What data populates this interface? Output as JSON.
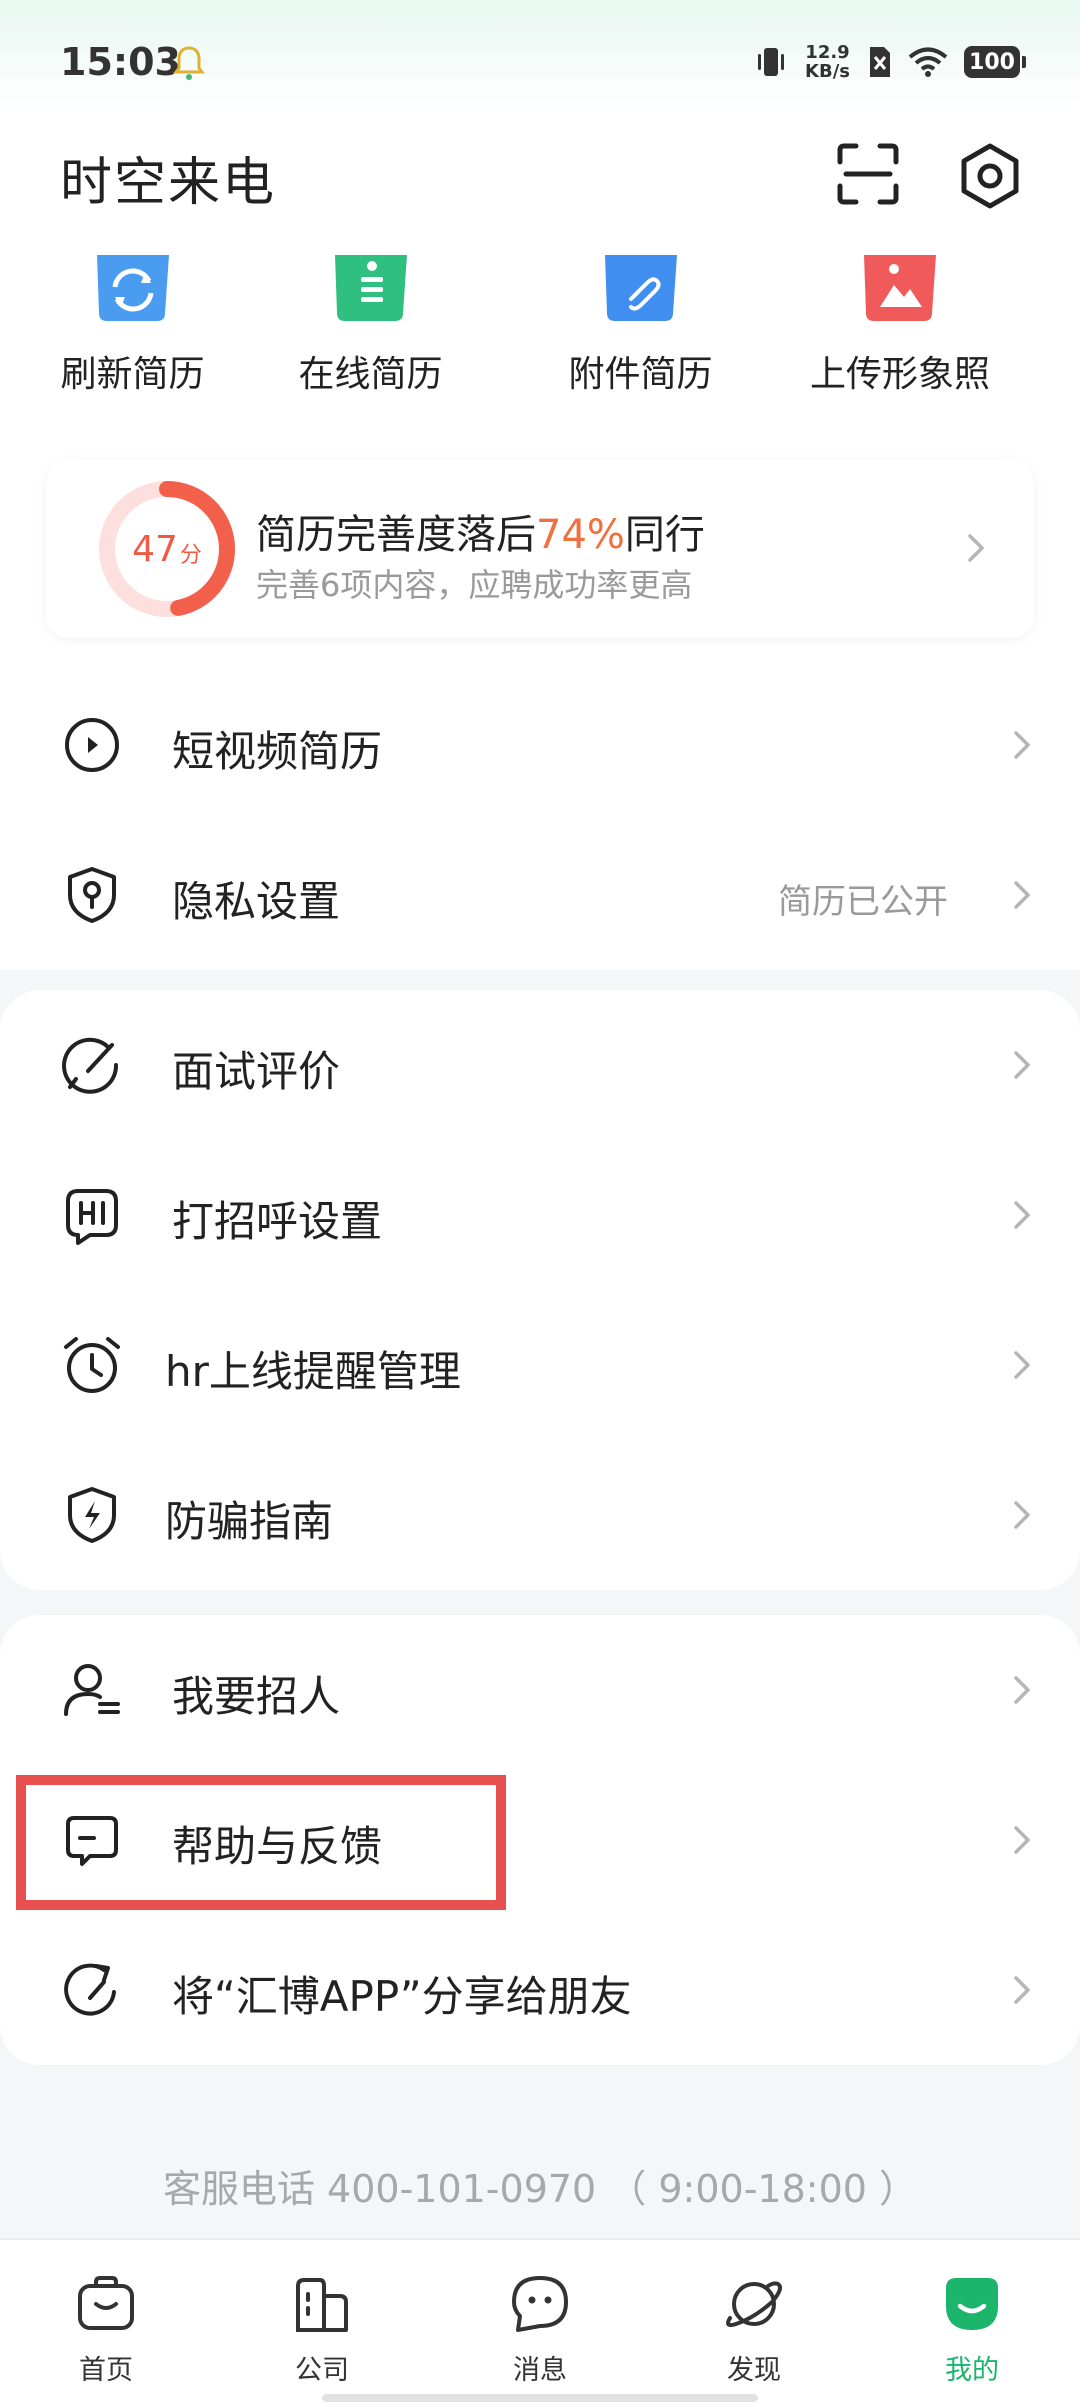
{
  "status_bar": {
    "time": "15:03",
    "speed_value": "12.9",
    "speed_unit": "KB/s",
    "battery": "100"
  },
  "header": {
    "title": "时空来电"
  },
  "quick_actions": [
    {
      "label": "刷新简历",
      "icon": "refresh-resume-icon"
    },
    {
      "label": "在线简历",
      "icon": "online-resume-icon"
    },
    {
      "label": "附件简历",
      "icon": "attachment-resume-icon"
    },
    {
      "label": "上传形象照",
      "icon": "upload-photo-icon"
    }
  ],
  "resume_card": {
    "score": "47",
    "score_unit": "分",
    "score_fraction": 0.47,
    "title_prefix": "简历完善度落后",
    "title_highlight": "74%",
    "title_suffix": "同行",
    "subtitle": "完善6项内容，应聘成功率更高"
  },
  "menu": {
    "section1": [
      {
        "label": "短视频简历",
        "value": ""
      },
      {
        "label": "隐私设置",
        "value": "简历已公开"
      }
    ],
    "section2": [
      {
        "label": "面试评价"
      },
      {
        "label": "打招呼设置"
      },
      {
        "label": "hr上线提醒管理"
      },
      {
        "label": "防骗指南"
      }
    ],
    "section3": [
      {
        "label": "我要招人"
      },
      {
        "label": "帮助与反馈"
      },
      {
        "label": "将“汇博APP”分享给朋友"
      }
    ]
  },
  "footer": {
    "service_phone": "客服电话 400-101-0970 （ 9:00-18:00 ）"
  },
  "bottom_nav": [
    {
      "label": "首页",
      "active": false
    },
    {
      "label": "公司",
      "active": false
    },
    {
      "label": "消息",
      "active": false
    },
    {
      "label": "发现",
      "active": false
    },
    {
      "label": "我的",
      "active": true
    }
  ],
  "colors": {
    "accent_green": "#1bb56b",
    "highlight_orange": "#f0703f",
    "ring_red": "#ef5a45",
    "annotation_red": "#e8504f"
  }
}
